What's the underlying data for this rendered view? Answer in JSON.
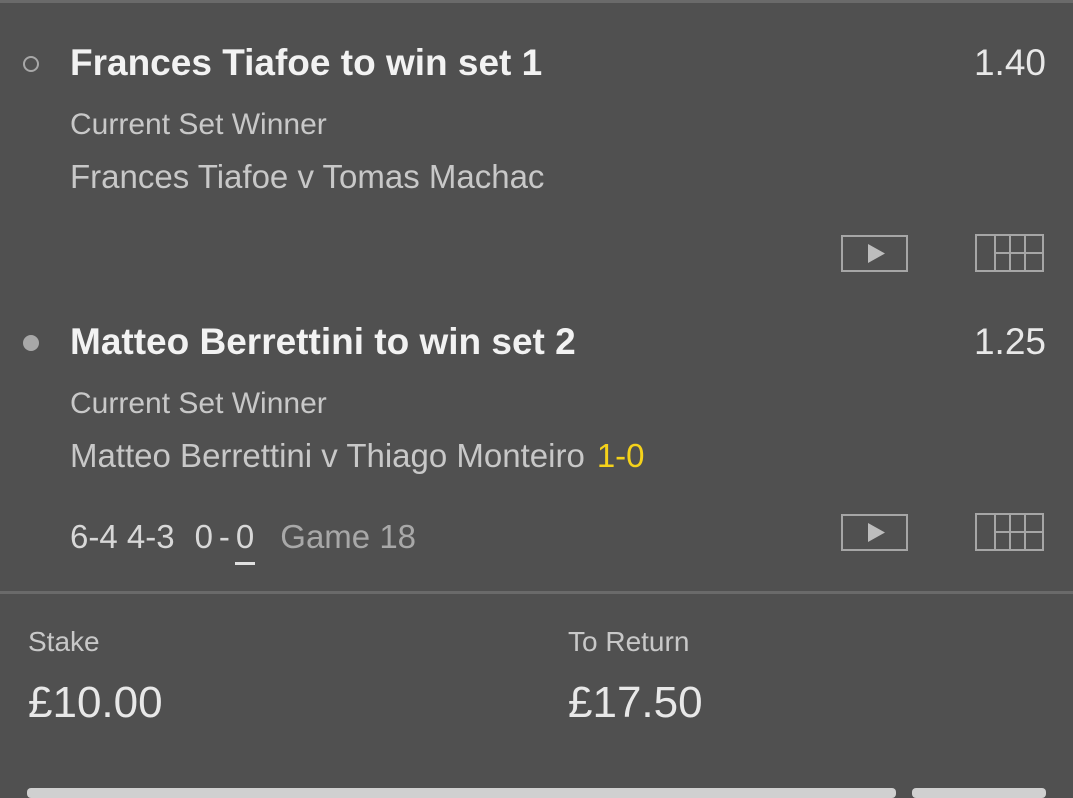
{
  "selections": [
    {
      "status": "not-started",
      "title": "Frances Tiafoe to win set 1",
      "odds": "1.40",
      "market": "Current Set Winner",
      "event": "Frances Tiafoe v Tomas Machac"
    },
    {
      "status": "live",
      "title": "Matteo Berrettini to win set 2",
      "odds": "1.25",
      "market": "Current Set Winner",
      "event": "Matteo Berrettini v Thiago Monteiro",
      "live_score": "1-0",
      "set_scores": "6-4 4-3",
      "point_a": "0",
      "point_sep": "-",
      "point_b": "0",
      "game_info": "Game 18"
    }
  ],
  "bet": {
    "stake_label": "Stake",
    "stake_value": "£10.00",
    "return_label": "To Return",
    "return_value": "£17.50"
  },
  "icons": {
    "play": "play-icon",
    "stats": "scoreboard-icon"
  },
  "colors": {
    "background": "#505050",
    "live_score": "#f5d21a",
    "divider": "#6a6a6a"
  }
}
